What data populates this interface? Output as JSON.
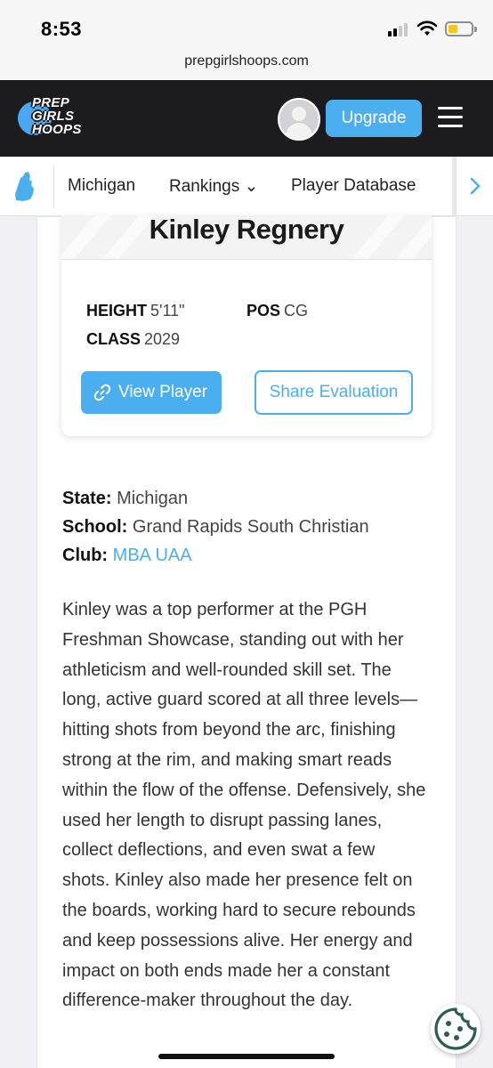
{
  "status_bar": {
    "time": "8:53"
  },
  "browser": {
    "url": "prepgirlshoops.com"
  },
  "header": {
    "logo_lines": [
      "PREP",
      "GIRLS",
      "HOOPS"
    ],
    "upgrade_label": "Upgrade"
  },
  "sub_nav": {
    "items": [
      {
        "label": "Michigan"
      },
      {
        "label": "Rankings ⌄"
      },
      {
        "label": "Player Database"
      }
    ]
  },
  "player": {
    "name": "Kinley Regnery",
    "height_label": "HEIGHT",
    "height": "5'11\"",
    "pos_label": "POS",
    "pos": "CG",
    "class_label": "CLASS",
    "class": "2029",
    "view_label": "View Player",
    "share_label": "Share Evaluation"
  },
  "info": {
    "state_label": "State:",
    "state": "Michigan",
    "school_label": "School:",
    "school": "Grand Rapids South Christian",
    "club_label": "Club:",
    "club": "MBA UAA"
  },
  "evaluation": "Kinley was a top performer at the PGH Freshman Showcase, standing out with her athleticism and well-rounded skill set. The long, active guard scored at all three levels—hitting shots from beyond the arc, finishing strong at the rim, and making smart reads within the flow of the offense. Defensively, she used her length to disrupt passing lanes, collect deflections, and even swat a few shots. Kinley also made her presence felt on the boards, working hard to secure rebounds and keep possessions alive. Her energy and impact on both ends made her a constant difference-maker throughout the day.",
  "colors": {
    "accent": "#4aaeef",
    "header_bg": "#1c1c1e",
    "cookie": "#2e5c52"
  },
  "icons": [
    "signal-icon",
    "wifi-icon",
    "battery-icon",
    "logo",
    "avatar",
    "menu-icon",
    "michigan-icon",
    "chevron-right-icon",
    "link-icon",
    "cookie-icon"
  ]
}
